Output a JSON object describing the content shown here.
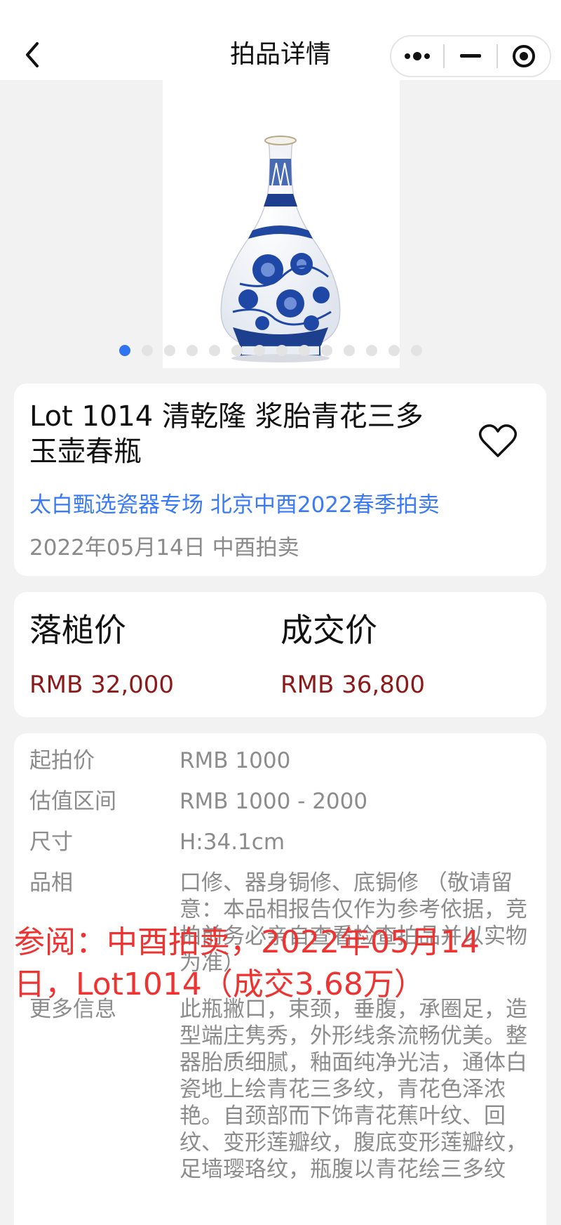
{
  "header": {
    "title": "拍品详情",
    "back_icon": "chevron-left-icon",
    "capsule": {
      "more_icon": "more-dots-icon",
      "minimize_icon": "minimize-icon",
      "close_icon": "target-icon"
    }
  },
  "gallery": {
    "image": "blue-and-white-porcelain-vase",
    "slide_count": 14,
    "active_index": 0,
    "active_color": "#2f74f0"
  },
  "lot": {
    "title": "Lot 1014 清乾隆 浆胎青花三多玉壶春瓶",
    "session": "太白甄选瓷器专场 北京中酉2022春季拍卖",
    "date_house": "2022年05月14日 中酉拍卖",
    "favorite_icon": "heart-outline-icon"
  },
  "prices": {
    "hammer_label": "落槌价",
    "hammer_value": "RMB 32,000",
    "sold_label": "成交价",
    "sold_value": "RMB 36,800",
    "value_color": "#8b1a1a"
  },
  "info": {
    "rows": [
      {
        "label": "起拍价",
        "value": "RMB 1000"
      },
      {
        "label": "估值区间",
        "value": "RMB 1000 - 2000"
      },
      {
        "label": "尺寸",
        "value": "H:34.1cm"
      },
      {
        "label": "品相",
        "value": "口修、器身锔修、底锔修 （敬请留意：本品相报告仅作为参考依据，竞拍前务必亲自查看检查拍品并以实物为准）"
      },
      {
        "label": "更多信息",
        "value": "此瓶撇口，束颈，垂腹，承圈足，造型端庄隽秀，外形线条流畅优美。整器胎质细腻，釉面纯净光洁，通体白瓷地上绘青花三多纹，青花色泽浓艳。自颈部而下饰青花蕉叶纹、回纹、变形莲瓣纹，腹底变形莲瓣纹，足墙璎珞纹，瓶腹以青花绘三多纹"
      }
    ]
  },
  "watermark": {
    "text": "参阅：中酉拍卖，2022年05月14日，Lot1014（成交3.68万）",
    "color": "#ee3333"
  }
}
